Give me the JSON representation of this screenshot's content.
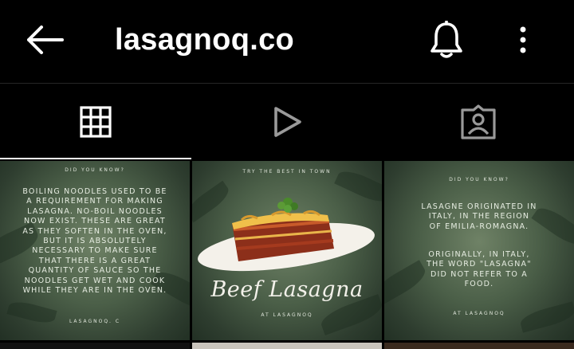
{
  "header": {
    "username": "lasagnoq.co"
  },
  "icons": {
    "back": "arrow-left-icon",
    "notifications": "bell-icon",
    "more": "vertical-dots-icon",
    "tab_grid": "grid-icon",
    "tab_reels": "play-icon",
    "tab_tagged": "tagged-person-icon"
  },
  "posts": [
    {
      "kicker": "DID YOU KNOW?",
      "body": "BOILING NOODLES USED TO BE A REQUIREMENT FOR MAKING LASAGNA. NO-BOIL NOODLES NOW EXIST. THESE ARE GREAT AS THEY SOFTEN IN THE OVEN, BUT IT IS ABSOLUTELY NECESSARY TO MAKE SURE THAT THERE IS A GREAT QUANTITY OF SAUCE SO THE NOODLES GET WET AND COOK WHILE THEY ARE IN THE OVEN.",
      "footer": "LASAGNOQ. C"
    },
    {
      "kicker": "TRY THE BEST IN TOWN",
      "title": "Beef Lasagna",
      "footer": "AT LASAGNOQ"
    },
    {
      "kicker": "DID YOU KNOW?",
      "body1": "LASAGNE ORIGINATED IN ITALY, IN THE REGION OF EMILIA-ROMAGNA.",
      "body2": "ORIGINALLY, IN ITALY, THE WORD \"LASAGNA\" DID NOT REFER TO A FOOD.",
      "footer": "AT LASAGNOQ"
    }
  ],
  "colors": {
    "background": "#000000",
    "active_tab_indicator": "#ffffff",
    "inactive_icon": "#9a9a9a"
  }
}
